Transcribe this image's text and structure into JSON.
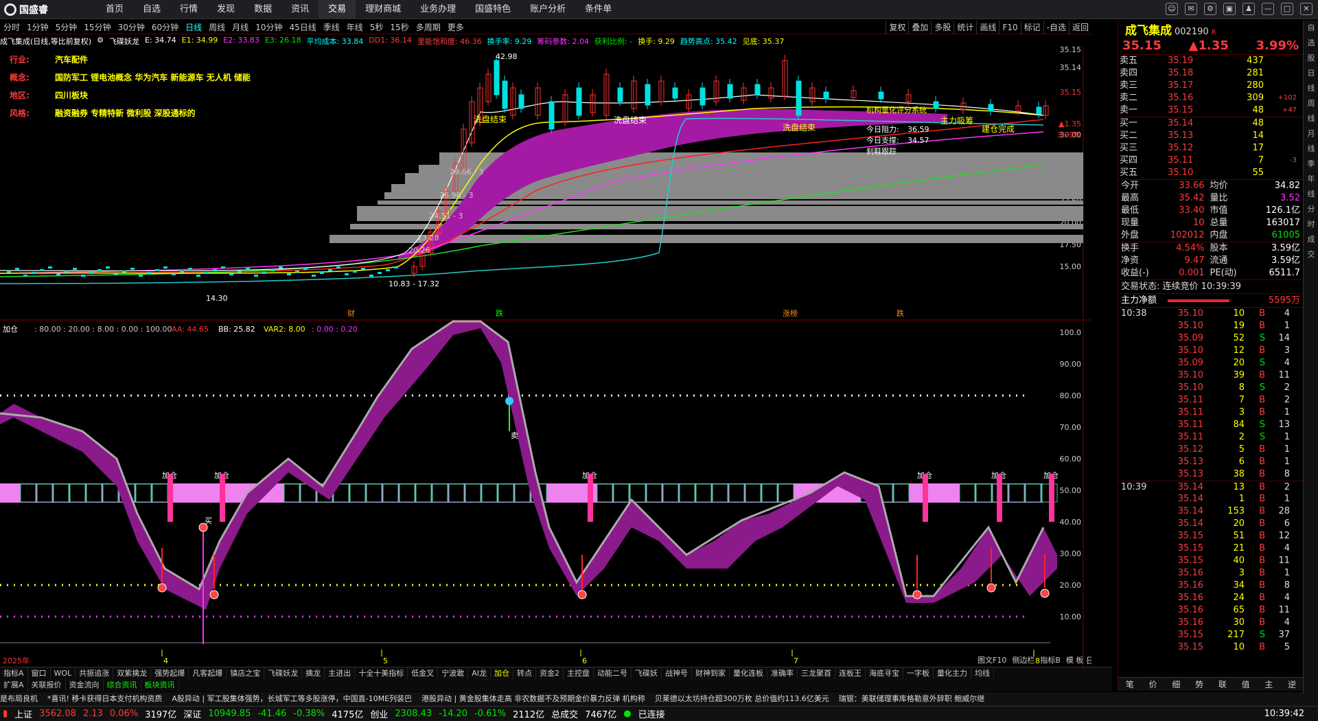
{
  "menu": {
    "brand": "国盛睿",
    "items": [
      "首页",
      "自选",
      "行情",
      "发现",
      "数据",
      "资讯",
      "交易",
      "理财商城",
      "业务办理",
      "国盛特色",
      "账户分析",
      "条件单"
    ],
    "active": "交易"
  },
  "periods": [
    "分时",
    "1分钟",
    "5分钟",
    "15分钟",
    "30分钟",
    "60分钟",
    "日线",
    "周线",
    "月线",
    "10分钟",
    "45日线",
    "季线",
    "年线",
    "5秒",
    "15秒",
    "多周期",
    "更多"
  ],
  "period_active": "日线",
  "tools": [
    "复权",
    "叠加",
    "多股",
    "统计",
    "画线",
    "F10",
    "标记",
    "-自选",
    "返回"
  ],
  "info": {
    "title": "成飞集成(日线,等比前复权)",
    "indicator": "飞碟妖龙",
    "e": "E: 34.74",
    "e1": "E1: 34.99",
    "e2": "E2: 33.83",
    "e3": "E3: 26.18",
    "avg": "平均成本: 33.84",
    "dd1": "DD1: 36.14",
    "ldgx": "里能饱和度: 46.36",
    "hsl": "换手率: 9.29",
    "cmcy": "筹码参数: 2.04",
    "hlbl": "获利比例: -",
    "hs": "换手: 9.29",
    "qsgd": "趋势高点: 35.42",
    "jd": "见底: 35.37"
  },
  "tags": [
    {
      "k": "行业:",
      "v": "汽车配件"
    },
    {
      "k": "概念:",
      "v": "国防军工 锂电池概念 华为汽车 新能源车 无人机 储能"
    },
    {
      "k": "地区:",
      "v": "四川板块"
    },
    {
      "k": "风格:",
      "v": "融资融券 专精特新 微利股 深股通标的"
    }
  ],
  "price_labels": {
    "high": "42.98",
    "low": "14.30",
    "range": "10.83 - 17.32",
    "xpjs1": "洗盘结束",
    "xpjs2": "洗盘结束",
    "xpjs3": "洗盘结束",
    "zhuli": "主力吸筹",
    "jcwc": "建仓完成",
    "zldz": "机构量化评分系统",
    "jrzl": "今日阻力:",
    "jrzl_v": "36.59",
    "jrzc": "今日支撑:",
    "jrzc_v": "34.57",
    "zsjl": "刹鞋跟踪",
    "lv1": "29.66 - 3",
    "lv2": "26.96 - 3",
    "lv3": "24.51 - 3",
    "lv4": "23.28",
    "lv5": "20.26"
  },
  "yaxis_top": [
    "35.15",
    "35.14",
    "35.15",
    "30.00",
    "27.50",
    "25.00",
    "22.50",
    "20.00",
    "17.50",
    "15.00"
  ],
  "price_axis_marks": [
    "▲1.35",
    "3.99%"
  ],
  "events": [
    "财",
    "跌",
    "涨榜",
    "跌"
  ],
  "sub_info": {
    "name": "加仓",
    "v": ": 80.00 : 20.00 : 8.00 : 0.00 : 100.00",
    "aa": "AA: 44.65",
    "bb": "BB: 25.82",
    "var2": "VAR2: 8.00",
    "tail": ": 0.00 : 0.20"
  },
  "yaxis_bottom": [
    "100.0",
    "90.00",
    "80.00",
    "70.00",
    "60.00",
    "50.00",
    "40.00",
    "30.00",
    "20.00",
    "10.00"
  ],
  "jiacang": "加仓",
  "buy": "买",
  "sell": "卖",
  "months": [
    "2025年",
    "4",
    "5",
    "6",
    "7",
    "8"
  ],
  "axis_label": "日线",
  "bottom_tabs": [
    "指标A",
    "窗口",
    "WOL",
    "共振追涨",
    "双紫擒龙",
    "强势起爆",
    "凡客起爆",
    "镇店之宝",
    "飞碟妖龙",
    "擒龙",
    "主进出",
    "十全十美指标",
    "低金叉",
    "宁波敢",
    "AI龙",
    "加仓",
    "转点",
    "资金2",
    "主控盘",
    "动能二号",
    "飞碟妖",
    "战神号",
    "财神到家",
    "量化连板",
    "准确率",
    "三龙聚首",
    "连板王",
    "海底寻宝",
    "一字板",
    "量化主力",
    "均线"
  ],
  "bottom_tabs2": [
    "扩展A",
    "关联报价",
    "资金流向",
    "综合资讯",
    "板块资讯"
  ],
  "bottom_right": [
    "图文F10",
    "侧边栏",
    "指标B",
    "模 板"
  ],
  "news": [
    "是布局良机",
    "*喜讯! 移卡获得日本支付机构资质",
    "A股异动 | 军工股集体强势，长城军工等多股涨停，中国直-10ME列装巴",
    "港股异动 | 黄金股集体走高 非农数据不及预期金价暴力反弹 机构称",
    "贝莱德以太坊持仓超300万枚 总价值约113.6亿美元",
    "瑞银：美联储理事库格勒意外辞职 鲍威尔继"
  ],
  "status": {
    "sh": "上证",
    "sh_v": "3562.08",
    "sh_c": "2.13",
    "sh_p": "0.06%",
    "sh_a": "3197亿",
    "sz": "深证",
    "sz_v": "10949.85",
    "sz_c": "-41.46",
    "sz_p": "-0.38%",
    "sz_a": "4175亿",
    "cy": "创业",
    "cy_v": "2308.43",
    "cy_c": "-14.20",
    "cy_p": "-0.61%",
    "cy_a": "2112亿",
    "zc": "总成交",
    "zc_v": "7467亿",
    "conn": "已连接",
    "time": "10:39:42"
  },
  "stock": {
    "name": "成飞集成",
    "code": "002190",
    "flag": "R",
    "price": "35.15",
    "chg": "▲1.35",
    "pct": "3.99%"
  },
  "asks": [
    {
      "l": "卖五",
      "p": "35.19",
      "v": "437",
      "d": ""
    },
    {
      "l": "卖四",
      "p": "35.18",
      "v": "281",
      "d": ""
    },
    {
      "l": "卖三",
      "p": "35.17",
      "v": "280",
      "d": ""
    },
    {
      "l": "卖二",
      "p": "35.16",
      "v": "309",
      "d": "+102"
    },
    {
      "l": "卖一",
      "p": "35.15",
      "v": "48",
      "d": "+47"
    }
  ],
  "bids": [
    {
      "l": "买一",
      "p": "35.14",
      "v": "48",
      "d": ""
    },
    {
      "l": "买二",
      "p": "35.13",
      "v": "14",
      "d": ""
    },
    {
      "l": "买三",
      "p": "35.12",
      "v": "17",
      "d": ""
    },
    {
      "l": "买四",
      "p": "35.11",
      "v": "7",
      "d": "-3"
    },
    {
      "l": "买五",
      "p": "35.10",
      "v": "55",
      "d": ""
    }
  ],
  "quote": [
    {
      "a": "今开",
      "av": "33.66",
      "b": "均价",
      "bv": "34.82"
    },
    {
      "a": "最高",
      "av": "35.42",
      "b": "量比",
      "bv": "3.52"
    },
    {
      "a": "最低",
      "av": "33.40",
      "b": "市值",
      "bv": "126.1亿"
    },
    {
      "a": "现量",
      "av": "10",
      "b": "总量",
      "bv": "163017"
    },
    {
      "a": "外盘",
      "av": "102012",
      "b": "内盘",
      "bv": "61005"
    }
  ],
  "quote2": [
    {
      "a": "换手",
      "av": "4.54%",
      "b": "股本",
      "bv": "3.59亿"
    },
    {
      "a": "净资",
      "av": "9.47",
      "b": "流通",
      "bv": "3.59亿"
    },
    {
      "a": "收益(-)",
      "av": "0.001",
      "b": "PE(动)",
      "bv": "6511.7"
    }
  ],
  "trade_state": "交易状态: 连续竞价 10:39:39",
  "zljz": {
    "label": "主力净额",
    "value": "5595万"
  },
  "ticks": [
    {
      "t": "10:38",
      "p": "35.10",
      "v": "10",
      "s": "B",
      "n": "4"
    },
    {
      "t": "",
      "p": "35.10",
      "v": "19",
      "s": "B",
      "n": "1"
    },
    {
      "t": "",
      "p": "35.09",
      "v": "52",
      "s": "S",
      "n": "14"
    },
    {
      "t": "",
      "p": "35.10",
      "v": "12",
      "s": "B",
      "n": "3"
    },
    {
      "t": "",
      "p": "35.09",
      "v": "20",
      "s": "S",
      "n": "4"
    },
    {
      "t": "",
      "p": "35.10",
      "v": "39",
      "s": "B",
      "n": "11"
    },
    {
      "t": "",
      "p": "35.10",
      "v": "8",
      "s": "S",
      "n": "2"
    },
    {
      "t": "",
      "p": "35.11",
      "v": "7",
      "s": "B",
      "n": "2"
    },
    {
      "t": "",
      "p": "35.11",
      "v": "3",
      "s": "B",
      "n": "1"
    },
    {
      "t": "",
      "p": "35.11",
      "v": "84",
      "s": "S",
      "n": "13"
    },
    {
      "t": "",
      "p": "35.11",
      "v": "2",
      "s": "S",
      "n": "1"
    },
    {
      "t": "",
      "p": "35.12",
      "v": "5",
      "s": "B",
      "n": "1"
    },
    {
      "t": "",
      "p": "35.13",
      "v": "6",
      "s": "B",
      "n": "1"
    },
    {
      "t": "",
      "p": "35.13",
      "v": "38",
      "s": "B",
      "n": "8"
    },
    {
      "t": "10:39",
      "p": "35.14",
      "v": "13",
      "s": "B",
      "n": "2"
    },
    {
      "t": "",
      "p": "35.14",
      "v": "1",
      "s": "B",
      "n": "1"
    },
    {
      "t": "",
      "p": "35.14",
      "v": "153",
      "s": "B",
      "n": "28"
    },
    {
      "t": "",
      "p": "35.14",
      "v": "20",
      "s": "B",
      "n": "6"
    },
    {
      "t": "",
      "p": "35.15",
      "v": "51",
      "s": "B",
      "n": "12"
    },
    {
      "t": "",
      "p": "35.15",
      "v": "21",
      "s": "B",
      "n": "4"
    },
    {
      "t": "",
      "p": "35.15",
      "v": "40",
      "s": "B",
      "n": "11"
    },
    {
      "t": "",
      "p": "35.16",
      "v": "3",
      "s": "B",
      "n": "1"
    },
    {
      "t": "",
      "p": "35.16",
      "v": "34",
      "s": "B",
      "n": "8"
    },
    {
      "t": "",
      "p": "35.16",
      "v": "24",
      "s": "B",
      "n": "4"
    },
    {
      "t": "",
      "p": "35.16",
      "v": "65",
      "s": "B",
      "n": "11"
    },
    {
      "t": "",
      "p": "35.16",
      "v": "30",
      "s": "B",
      "n": "4"
    },
    {
      "t": "",
      "p": "35.15",
      "v": "217",
      "s": "S",
      "n": "37"
    },
    {
      "t": "",
      "p": "35.15",
      "v": "10",
      "s": "B",
      "n": "5"
    }
  ],
  "rp_tabs": [
    "笔",
    "价",
    "细",
    "势",
    "联",
    "值",
    "主",
    "逆"
  ],
  "side": [
    "自",
    "选",
    "股",
    "日",
    "线",
    "周",
    "线",
    "月",
    "线",
    "季",
    "年",
    "线",
    "分",
    "时",
    "成",
    "交"
  ]
}
